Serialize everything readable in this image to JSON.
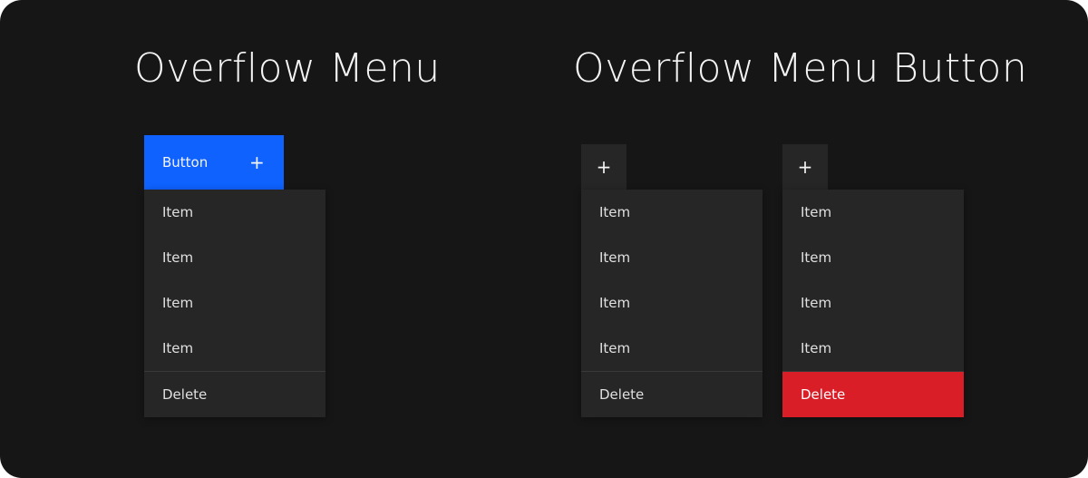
{
  "sections": {
    "overflow_menu": {
      "title": "Overflow Menu",
      "trigger": {
        "label": "Button",
        "icon": "+",
        "color": "#0f62fe"
      },
      "items": [
        "Item",
        "Item",
        "Item",
        "Item"
      ],
      "danger_item": "Delete"
    },
    "overflow_menu_button": {
      "title": "Overflow Menu Button",
      "variants": [
        {
          "trigger_icon": "+",
          "items": [
            "Item",
            "Item",
            "Item",
            "Item"
          ],
          "danger_item": "Delete",
          "danger_state": "default"
        },
        {
          "trigger_icon": "+",
          "items": [
            "Item",
            "Item",
            "Item",
            "Item"
          ],
          "danger_item": "Delete",
          "danger_state": "hover",
          "danger_color": "#da1e28"
        }
      ]
    }
  }
}
